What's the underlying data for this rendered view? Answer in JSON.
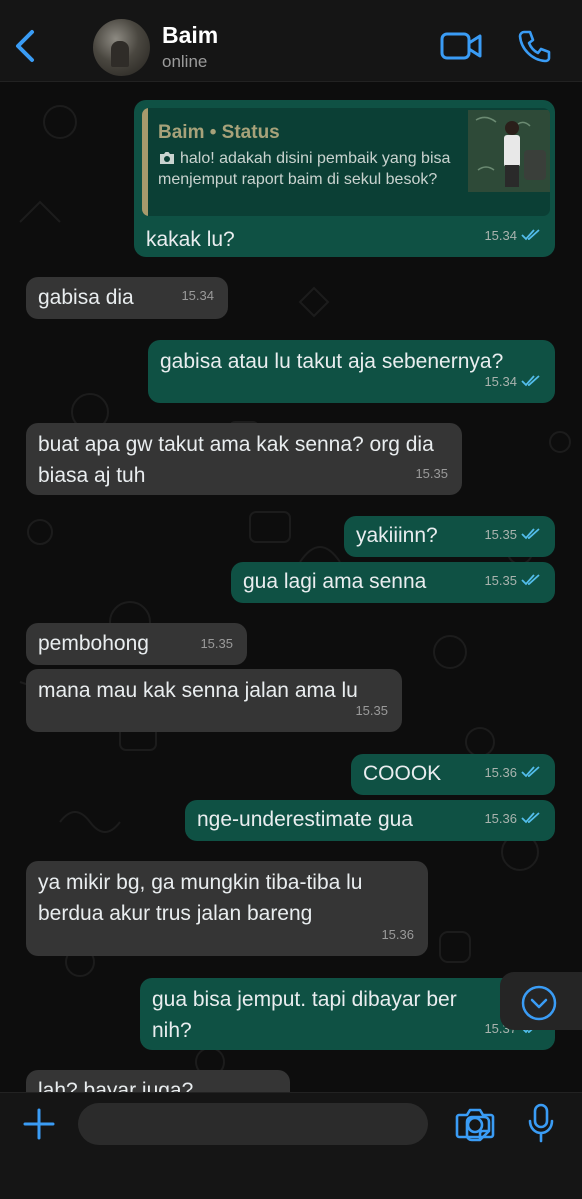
{
  "header": {
    "contact_name": "Baim",
    "status": "online"
  },
  "colors": {
    "accent": "#3a9cf5",
    "incoming_bubble": "#353535",
    "outgoing_bubble": "#0f5144",
    "read_ticks": "#53bdeb"
  },
  "icons": [
    "back-chevron-icon",
    "video-call-icon",
    "phone-icon",
    "camera-icon",
    "check-double-icon",
    "chevron-down-icon",
    "plus-icon",
    "sticker-icon",
    "microphone-icon"
  ],
  "reply": {
    "name": "Baim • Status",
    "text": "halo! adakah disini pembaik yang bisa menjemput raport baim di sekul besok?"
  },
  "messages": [
    {
      "dir": "out",
      "text": "kakak lu?",
      "time": "15.34"
    },
    {
      "dir": "in",
      "text": "gabisa dia",
      "time": "15.34"
    },
    {
      "dir": "out",
      "text": "gabisa atau lu takut aja sebenernya?",
      "time": "15.34"
    },
    {
      "dir": "in",
      "text": "buat apa gw takut ama kak senna? org dia biasa aj tuh",
      "time": "15.35"
    },
    {
      "dir": "out",
      "text": "yakiiinn?",
      "time": "15.35"
    },
    {
      "dir": "out",
      "text": "gua lagi ama senna",
      "time": "15.35"
    },
    {
      "dir": "in",
      "text": "pembohong",
      "time": "15.35"
    },
    {
      "dir": "in",
      "text": "mana mau kak senna jalan ama lu",
      "time": "15.35"
    },
    {
      "dir": "out",
      "text": "COOOK",
      "time": "15.36"
    },
    {
      "dir": "out",
      "text": "nge-underestimate gua",
      "time": "15.36"
    },
    {
      "dir": "in",
      "text": "ya mikir bg, ga mungkin tiba-tiba lu berdua akur trus jalan bareng",
      "time": "15.36"
    },
    {
      "dir": "out",
      "text": "gua bisa jemput. tapi dibayar ber nih?",
      "time": "15.37"
    },
    {
      "dir": "in",
      "text": "lah? bayar juga?",
      "time": ""
    }
  ],
  "input": {
    "placeholder": ""
  }
}
